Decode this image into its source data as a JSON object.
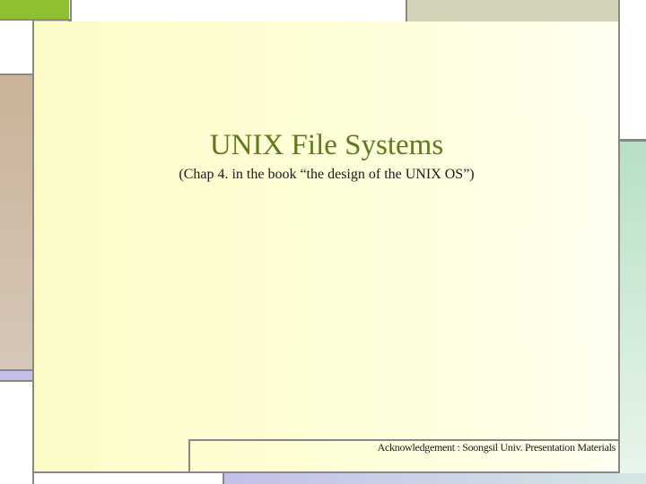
{
  "slide": {
    "title": "UNIX File Systems",
    "subtitle": "(Chap 4. in the book “the design of the UNIX OS”)",
    "acknowledgement": "Acknowledgement : Soongsil Univ. Presentation Materials"
  },
  "colors": {
    "title": "#5e7a1e",
    "panel_yellow": "#fdfbc6",
    "accent_green": "#8fc031",
    "tan": "#c8b49a",
    "olive_gray": "#d2d3b8",
    "mint": "#c0e4cc",
    "lavender": "#c3c0e8",
    "border": "#888888"
  }
}
